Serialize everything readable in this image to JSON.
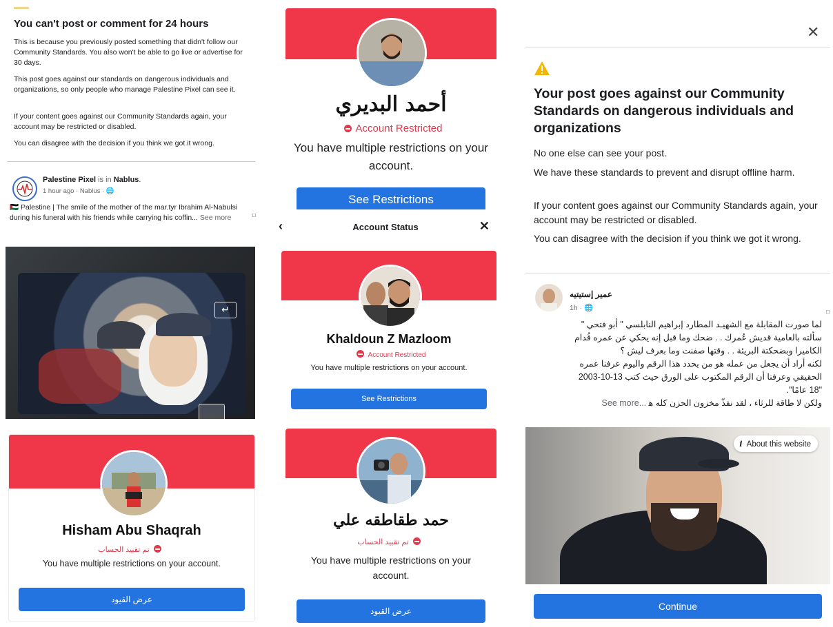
{
  "left_notice": {
    "title": "You can't post or comment for 24 hours",
    "p1": "This is because you previously posted something that didn't follow our Community Standards. You also won't be able to go live or advertise for 30 days.",
    "p2": "This post goes against our standards on dangerous individuals and organizations, so only people who manage Palestine Pixel can see it.",
    "p3": "If your content goes against our Community Standards again, your account may be restricted or disabled.",
    "p4": "You can disagree with the decision if you think we got it wrong."
  },
  "left_post": {
    "page_name": "Palestine Pixel",
    "is_in": "is in",
    "location": "Nablus",
    "period": ".",
    "meta": "1 hour ago · Nablus · ",
    "text": "🇵🇸 Palestine | The smile of the mother of the mar.tyr Ibrahim Al-Nabulsi during his funeral with his friends while carrying his coffin... ",
    "see_more": "See more"
  },
  "account_status": {
    "title": "Account Status",
    "back_glyph": "‹",
    "close_glyph": "✕"
  },
  "cards": {
    "ahmad": {
      "name": "أحمد البديري",
      "status": "Account Restricted",
      "message": "You have multiple restrictions on your account.",
      "button": "See Restrictions"
    },
    "khaldoun": {
      "name": "Khaldoun Z Mazloom",
      "status": "Account Restricted",
      "message": "You have multiple restrictions on your account.",
      "button": "See Restrictions"
    },
    "hisham": {
      "name": "Hisham Abu Shaqrah",
      "status": "تم تقييد الحساب",
      "message": "You have multiple restrictions on your account.",
      "button": "عرض القيود"
    },
    "hamad": {
      "name": "حمد طقاطقه علي",
      "status": "تم تقييد الحساب",
      "message": "You have multiple restrictions on your account.",
      "button": "عرض القيود"
    }
  },
  "right_notice": {
    "close_glyph": "✕",
    "title": "Your post goes against our Community Standards on dangerous individuals and organizations",
    "p1": "No one else can see your post.",
    "p2": "We have these standards to prevent and disrupt offline harm.",
    "p3": "If your content goes against our Community Standards again, your account may be restricted or disabled.",
    "p4": "You can disagree with the decision if you think we got it wrong.",
    "continue": "Continue"
  },
  "right_post": {
    "author": "عمير إستيتيه",
    "meta": "1h · ",
    "line1": "لما صورت المقابلة مع الشهيـد المطارد إبراهيم النابلسي \" أبو فتحي \"",
    "line2": "سألته بالعامية قديش عُمرك . . ضحك وما قبل إنه يحكي عن عمره قُدام",
    "line3": "الكاميرا وبضحكتة البريئة . . وقتها صفنت وما بعرف ليش ؟",
    "line4": "لكنه أراد أن يجعل من عمله هو من يحدد هذا الرقم واليوم عرفنا عمره",
    "line5": "الحقيقي وعرفنا أن الرقم المكتوب على الورق حيث كتب 13-10-2003",
    "line6": "\"18 عامًا\".",
    "line7": "ولكن لا طاقة للرثاء ، لقد نفذّ مخزون الحزن كله ﻫ",
    "see_more": "See more...",
    "about_website": "About this website",
    "about_i": "i"
  },
  "colors": {
    "banner_red": "#f0374a",
    "button_blue": "#2374e1",
    "restricted_red": "#e0394b",
    "warning_yellow": "#f2b705"
  }
}
